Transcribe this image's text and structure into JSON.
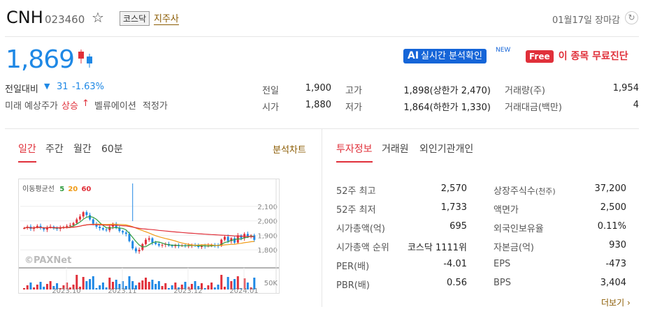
{
  "header": {
    "name": "CNH",
    "code": "023460",
    "market_tag": "코스닥",
    "group_tag": "지주사",
    "date_status": "01월17일 장마감"
  },
  "price": {
    "current": "1,869",
    "change_label": "전일대비",
    "change_arrow": "▼",
    "change_value": "31",
    "change_pct": "-1.63%",
    "forecast_label": "미래 예상주가",
    "forecast_value": "상승",
    "forecast_arrow": "↑",
    "valuation_label": "벨류에이션",
    "valuation_value": "적정가"
  },
  "promo": {
    "ai_label": "AI",
    "ai_text": "실시간 분석확인",
    "new_label": "NEW",
    "free_label": "Free",
    "free_text": "이 종목 무료진단"
  },
  "summary": [
    {
      "label": "전일",
      "value": "1,900",
      "color": "normal"
    },
    {
      "label": "시가",
      "value": "1,880",
      "color": "normal"
    },
    {
      "label": "고가",
      "value": "1,898(상한가 2,470)",
      "color": "up"
    },
    {
      "label": "저가",
      "value": "1,864(하한가 1,330)",
      "color": "down"
    },
    {
      "label": "거래량(주)",
      "value": "1,954",
      "color": "normal"
    },
    {
      "label": "거래대금(백만)",
      "value": "4",
      "color": "normal"
    }
  ],
  "chart_tabs": [
    "일간",
    "주간",
    "월간",
    "60분"
  ],
  "chart_link": "분석차트",
  "info_tabs": [
    "투자정보",
    "거래원",
    "외인기관개인"
  ],
  "chart_data": {
    "type": "candlestick",
    "legend_label": "이동평균선",
    "ma_periods": [
      {
        "label": "5",
        "color": "#2e9b3e"
      },
      {
        "label": "20",
        "color": "#f09a14"
      },
      {
        "label": "60",
        "color": "#e0303a"
      }
    ],
    "y_ticks": [
      "2,100",
      "2,000",
      "1,900",
      "1,800"
    ],
    "ylim": [
      1700,
      2200
    ],
    "volume_tick": "50K",
    "x_ticks": [
      "2023.10",
      "2023.11",
      "2023.12",
      "2024.01"
    ],
    "watermark": "©PAXNet",
    "closes": [
      1950,
      1960,
      1945,
      1955,
      1965,
      1950,
      1940,
      1955,
      1960,
      1950,
      1945,
      1952,
      1958,
      1965,
      1970,
      1985,
      2010,
      2030,
      2060,
      2040,
      2010,
      1980,
      1960,
      1950,
      1940,
      1935,
      1960,
      1980,
      1950,
      1930,
      1920,
      1910,
      1860,
      1810,
      1790,
      1800,
      1840,
      1870,
      1880,
      1850,
      1840,
      1830,
      1835,
      1840,
      1830,
      1825,
      1830,
      1828,
      1832,
      1826,
      1830,
      1835,
      1828,
      1820,
      1830,
      1825,
      1830,
      1835,
      1830,
      1828,
      1870,
      1890,
      1860,
      1880,
      1850,
      1900,
      1880,
      1910,
      1890,
      1900,
      1869
    ]
  },
  "invest": {
    "left": [
      {
        "label": "52주 최고",
        "value": "2,570"
      },
      {
        "label": "52주 최저",
        "value": "1,733"
      },
      {
        "label": "시가총액(억)",
        "value": "695"
      },
      {
        "label": "시가총액 순위",
        "value": "코스닥 1111위"
      },
      {
        "label": "PER(배)",
        "value": "-4.01"
      },
      {
        "label": "PBR(배)",
        "value": "0.56"
      }
    ],
    "right": [
      {
        "label": "상장주식수",
        "label_sub": "(천주)",
        "value": "37,200"
      },
      {
        "label": "액면가",
        "label_sub": "",
        "value": "2,500"
      },
      {
        "label": "외국인보유율",
        "label_sub": "",
        "value": "0.11%"
      },
      {
        "label": "자본금(억)",
        "label_sub": "",
        "value": "930"
      },
      {
        "label": "EPS",
        "label_sub": "",
        "value": "-473"
      },
      {
        "label": "BPS",
        "label_sub": "",
        "value": "3,404"
      }
    ],
    "more": "더보기"
  }
}
